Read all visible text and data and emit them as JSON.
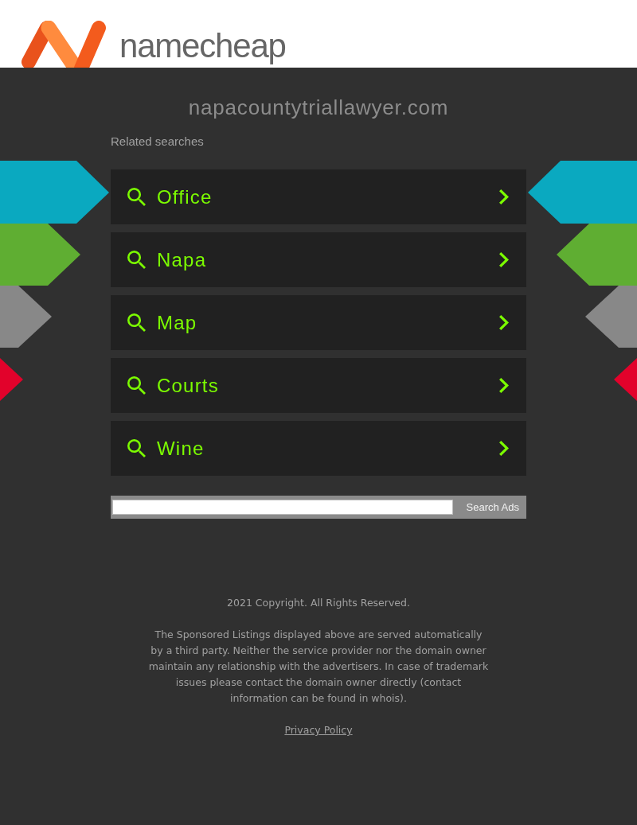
{
  "header": {
    "logo_text": "namecheap"
  },
  "domain": "napacountytriallawyer.com",
  "related_searches": {
    "heading": "Related searches",
    "links": [
      "Office",
      "Napa",
      "Map",
      "Courts",
      "Wine"
    ]
  },
  "search_form": {
    "button": "Search Ads"
  },
  "footer": {
    "copyright": "2021 Copyright. All Rights Reserved.",
    "disclaimer": "The Sponsored Listings displayed above are served automatically by a third party. Neither the service provider nor the domain owner maintain any relationship with the advertisers. In case of trademark issues please contact the domain owner directly (contact information can be found in whois).",
    "privacy_link": "Privacy Policy"
  }
}
